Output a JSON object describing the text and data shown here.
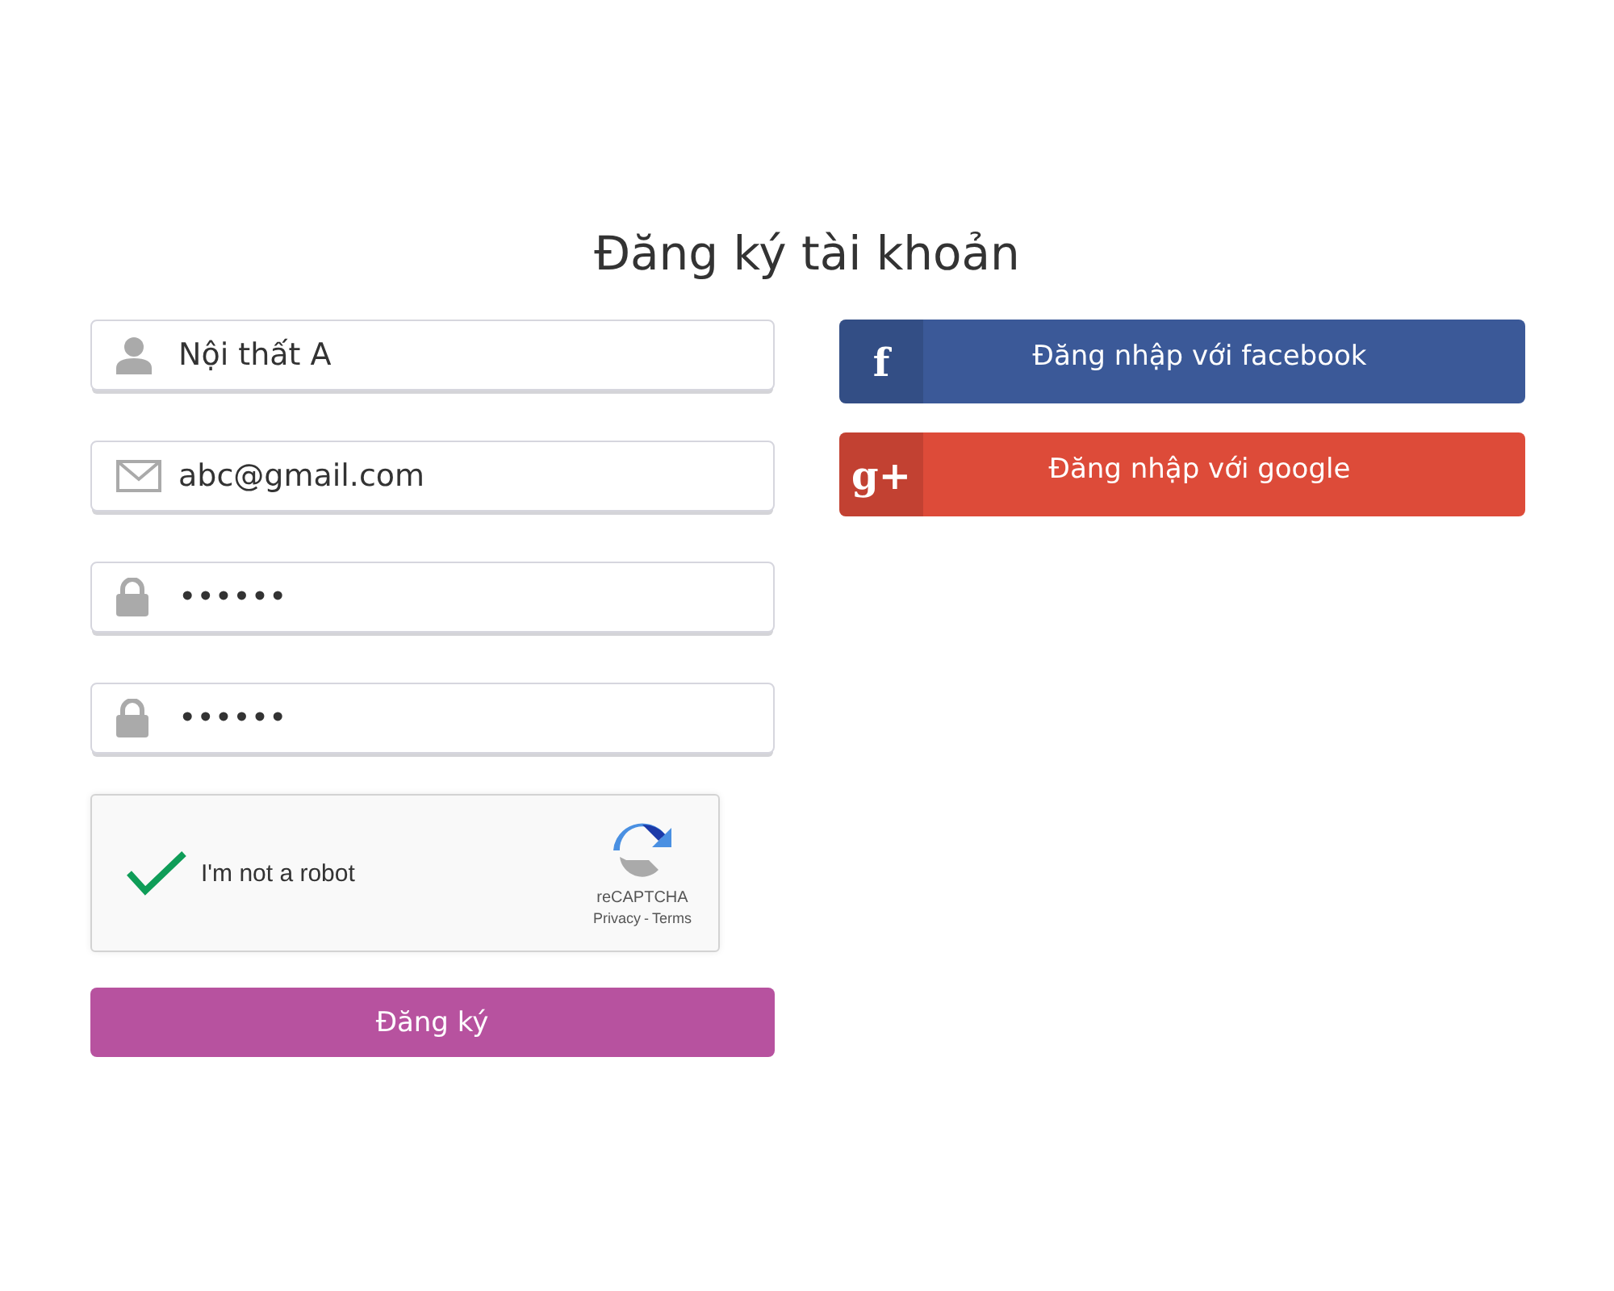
{
  "title": "Đăng ký tài khoản",
  "fields": [
    {
      "kind": "user",
      "value": "Nội thất A"
    },
    {
      "kind": "email",
      "value": "abc@gmail.com"
    },
    {
      "kind": "password",
      "value": "••••••"
    },
    {
      "kind": "password",
      "value": "••••••"
    }
  ],
  "captcha": {
    "checked": true,
    "label": "I'm not a robot",
    "brand": "reCAPTCHA",
    "privacy": "Privacy",
    "separator": "-",
    "terms": "Terms"
  },
  "submit": "Đăng ký",
  "social": [
    {
      "kind": "facebook",
      "icon": "f",
      "label": "Đăng nhập với facebook"
    },
    {
      "kind": "google",
      "icon": "g+",
      "label": "Đăng nhập với google"
    }
  ]
}
